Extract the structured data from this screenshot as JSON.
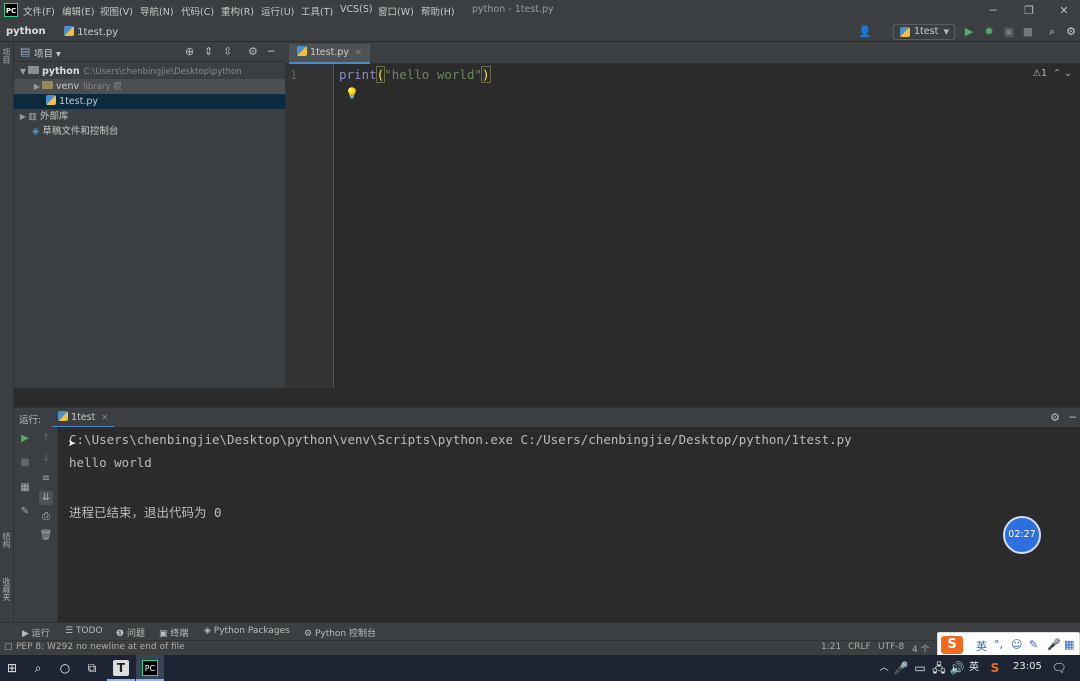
{
  "titlebar": {
    "app_logo": "PC",
    "menu": [
      "文件(F)",
      "编辑(E)",
      "视图(V)",
      "导航(N)",
      "代码(C)",
      "重构(R)",
      "运行(U)",
      "工具(T)",
      "VCS(S)",
      "窗口(W)",
      "帮助(H)"
    ],
    "window_title": "python - 1test.py"
  },
  "navbar": {
    "project": "python",
    "file": "1test.py",
    "run_config": "1test"
  },
  "project_panel": {
    "title": "项目",
    "tree": [
      {
        "label": "python",
        "path": "C:\\Users\\chenbingjie\\Desktop\\python",
        "expanded": true
      },
      {
        "label": "venv",
        "path": "library 根"
      },
      {
        "label": "1test.py",
        "selected": true
      },
      {
        "label": "外部库"
      },
      {
        "label": "草稿文件和控制台"
      }
    ]
  },
  "editor": {
    "tab_label": "1test.py",
    "line_number": "1",
    "code": {
      "fn": "print",
      "open": "(",
      "str": "\"hello world\"",
      "close": ")"
    },
    "inspection": "⚠1"
  },
  "run_panel": {
    "label": "运行:",
    "tab_label": "1test",
    "console": [
      "C:\\Users\\chenbingjie\\Desktop\\python\\venv\\Scripts\\python.exe C:/Users/chenbingjie/Desktop/python/1test.py",
      "hello world",
      "",
      "进程已结束，退出代码为 0"
    ]
  },
  "timer": "02:27",
  "tool_strip": [
    "运行",
    "TODO",
    "问题",
    "终端",
    "Python Packages",
    "Python 控制台"
  ],
  "statusbar": {
    "message": "PEP 8: W292 no newline at end of file",
    "position": "1:21",
    "line_sep": "CRLF",
    "encoding": "UTF-8",
    "indent": "4 个"
  },
  "ime": {
    "lang": "英"
  },
  "taskbar": {
    "clock": "23:05",
    "lang": "英"
  },
  "left_stripe": {
    "top": "项目",
    "bottom1": "结构",
    "bottom2": "收藏夹"
  },
  "colors": {
    "accent": "#4a88c7",
    "timer": "#2e6fe0",
    "ime": "#f06a1f"
  }
}
